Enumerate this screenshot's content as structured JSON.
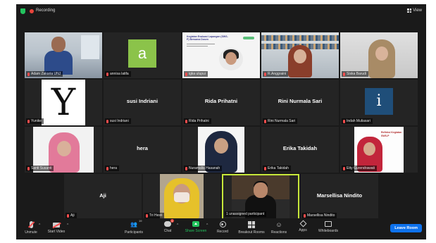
{
  "topbar": {
    "recording_label": "Recording",
    "view_label": "View"
  },
  "participants": [
    {
      "name": "Adam Zakaria UNJ",
      "type": "video"
    },
    {
      "name": "annisa latifa",
      "type": "avatar",
      "avatar_letter": "a",
      "avatar_color": "#8bc34a"
    },
    {
      "name": "igka ulupui",
      "type": "video",
      "slide_title": "Kegiatan Evaluasi Lapangan (SWS-P) Bersama Dosen"
    },
    {
      "name": "R.Anggraini",
      "type": "video"
    },
    {
      "name": "Siska Barudi",
      "type": "video"
    },
    {
      "name": "Yunike",
      "type": "image"
    },
    {
      "name": "susi Indriani",
      "type": "text"
    },
    {
      "name": "Rida Prihatni",
      "type": "text"
    },
    {
      "name": "Rini Nurmala Sari",
      "type": "text"
    },
    {
      "name": "Indah Muliasari",
      "type": "avatar",
      "avatar_letter": "i",
      "avatar_color": "#1f4e79"
    },
    {
      "name": "Santi Susanti",
      "type": "video"
    },
    {
      "name": "hera",
      "type": "text"
    },
    {
      "name": "Nuramalia Hasanah",
      "type": "video"
    },
    {
      "name": "Erika Takidah",
      "type": "text"
    },
    {
      "name": "Etty Gurendrawati",
      "type": "video",
      "poster_text": "Refleksi Kegiatan SWS-P"
    },
    {
      "name": "Aji",
      "type": "text"
    },
    {
      "name": "Tri Hesti",
      "type": "video"
    },
    {
      "name": "1 unassigned participant",
      "type": "video",
      "active_speaker": true
    },
    {
      "name": "Marsellisa Nindito",
      "type": "text"
    }
  ],
  "toolbar": {
    "unmute": "Unmute",
    "start_video": "Start Video",
    "participants": "Participants",
    "participants_count": "19",
    "chat": "Chat",
    "chat_badge": "1",
    "share_screen": "Share Screen",
    "record": "Record",
    "breakout_rooms": "Breakout Rooms",
    "reactions": "Reactions",
    "apps": "Apps",
    "whiteboards": "Whiteboards",
    "leave": "Leave Room"
  },
  "colors": {
    "share_green": "#23c45e",
    "leave_blue": "#0e72ed",
    "active_outline": "#c7e83a",
    "muted_red": "#ff4d4d"
  }
}
